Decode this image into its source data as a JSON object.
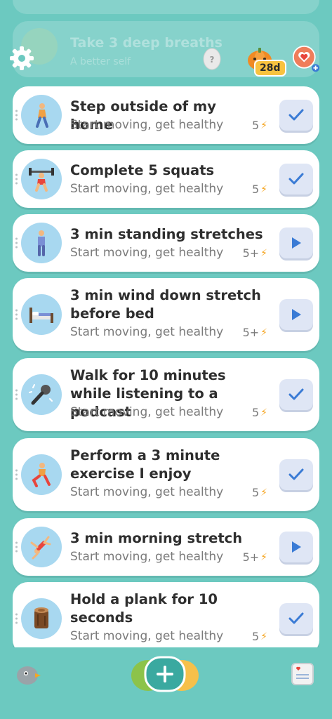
{
  "background_cards": [
    {
      "title": "Take 3 deep breaths",
      "subtitle": "A better self"
    }
  ],
  "top_bar": {
    "settings_icon": "gear-icon",
    "egg_icon": "mystery-egg-icon",
    "pet_icon": "pumpkin-pet-icon",
    "streak": "28d",
    "heart_icon": "heart-add-icon"
  },
  "goals": [
    {
      "title": "Step outside of my home",
      "subtitle": "Start moving, get healthy",
      "points": "5",
      "action": "check",
      "icon": "walking-person-icon"
    },
    {
      "title": "Complete 5 squats",
      "subtitle": "Start moving, get healthy",
      "points": "5",
      "action": "check",
      "icon": "weightlifter-icon"
    },
    {
      "title": "3 min standing stretches",
      "subtitle": "Start moving, get healthy",
      "points": "5+",
      "action": "play",
      "icon": "standing-person-icon"
    },
    {
      "title": "3 min wind down stretch before bed",
      "subtitle": "Start moving, get healthy",
      "points": "5+",
      "action": "play",
      "icon": "bed-icon"
    },
    {
      "title": "Walk for 10 minutes while listening to a podcast",
      "subtitle": "Start moving, get healthy",
      "points": "5",
      "action": "check",
      "icon": "microphone-icon"
    },
    {
      "title": "Perform a 3 minute exercise I enjoy",
      "subtitle": "Start moving, get healthy",
      "points": "5",
      "action": "check",
      "icon": "exercising-person-icon"
    },
    {
      "title": "3 min morning stretch",
      "subtitle": "Start moving, get healthy",
      "points": "5+",
      "action": "play",
      "icon": "cartwheel-person-icon"
    },
    {
      "title": "Hold a plank for 10 seconds",
      "subtitle": "Start moving, get healthy",
      "points": "5",
      "action": "check",
      "icon": "wood-log-icon"
    }
  ],
  "bottom_bar": {
    "left_icon": "bird-icon",
    "center_icon": "add-icon",
    "right_icon": "journal-icon"
  },
  "colors": {
    "background": "#6cc9c0",
    "action_button": "#dfe6f5",
    "accent_blue": "#3a7bd5",
    "bolt": "#f5a623",
    "avatar_bg": "#a8d8f0"
  }
}
